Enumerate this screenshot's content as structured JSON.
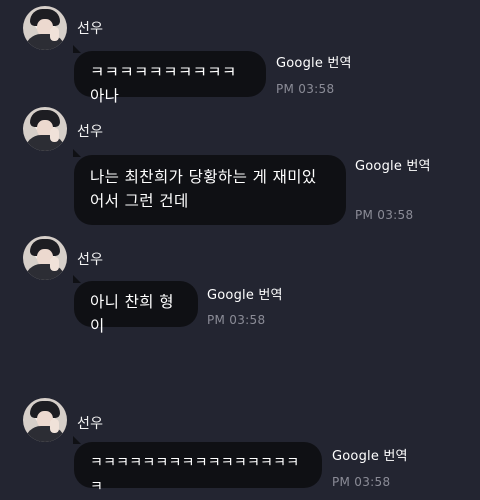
{
  "translation_label": "Google 번역",
  "messages": [
    {
      "sender": "선우",
      "text": "ㅋㅋㅋㅋㅋㅋㅋㅋㅋㅋ 아나",
      "time": "PM 03:58"
    },
    {
      "sender": "선우",
      "text": "나는 최찬희가 당황하는 게 재미있어서 그런 건데",
      "time": "PM 03:58"
    },
    {
      "sender": "선우",
      "text": "아니 찬희 형이",
      "time": "PM 03:58"
    },
    {
      "sender": "선우",
      "text": "ㅋㅋㅋㅋㅋㅋㅋㅋㅋㅋㅋㅋㅋㅋㅋㅋㅋ",
      "time": "PM 03:58"
    }
  ]
}
